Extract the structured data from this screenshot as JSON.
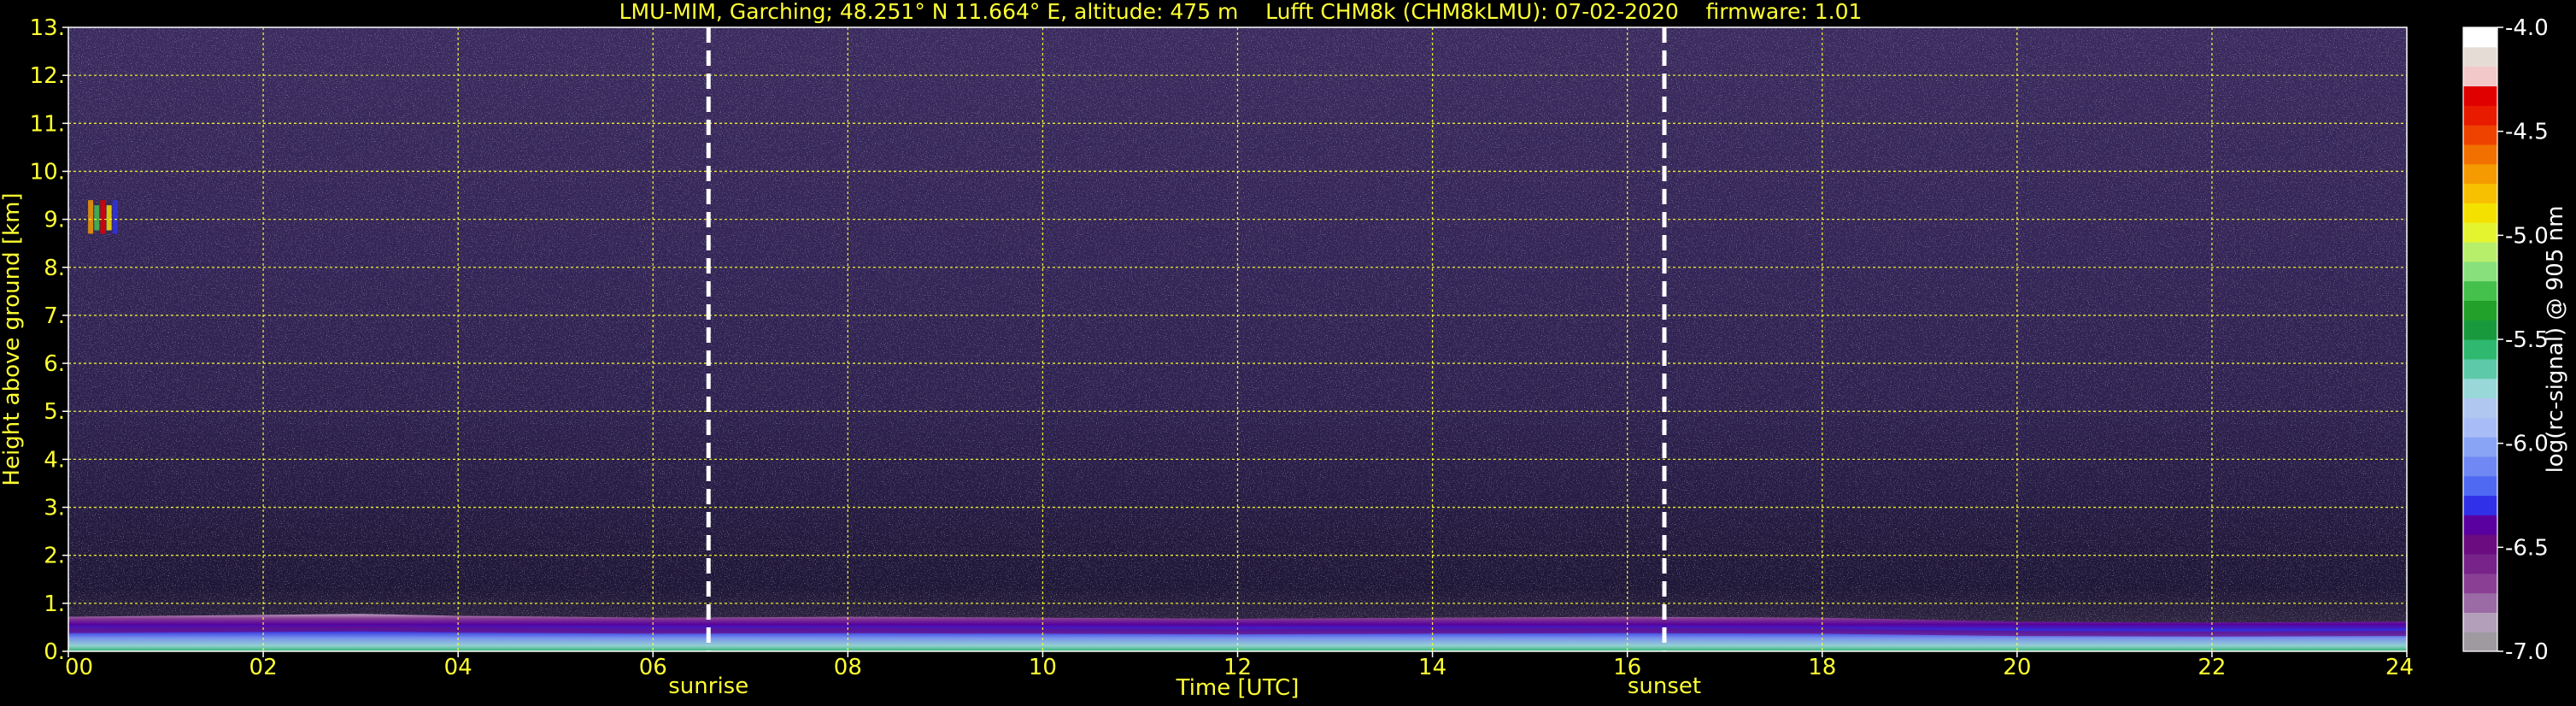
{
  "chart_data": {
    "type": "heatmap",
    "title": "LMU-MIM, Garching; 48.251° N 11.664° E, altitude: 475 m    Lufft CHM8k (CHM8kLMU): 07-02-2020    firmware: 1.01",
    "xlabel": "Time [UTC]",
    "ylabel": "Height above ground [km]",
    "xlim": [
      0,
      24
    ],
    "ylim": [
      0,
      13
    ],
    "x_ticks": [
      0,
      2,
      4,
      6,
      8,
      10,
      12,
      14,
      16,
      18,
      20,
      22,
      24
    ],
    "x_tick_labels": [
      "00",
      "02",
      "04",
      "06",
      "08",
      "10",
      "12",
      "14",
      "16",
      "18",
      "20",
      "22",
      "24"
    ],
    "y_ticks": [
      0,
      1,
      2,
      3,
      4,
      5,
      6,
      7,
      8,
      9,
      10,
      11,
      12,
      13
    ],
    "y_tick_labels": [
      "0.",
      "1.",
      "2.",
      "3.",
      "4.",
      "5.",
      "6.",
      "7.",
      "8.",
      "9.",
      "10.",
      "11.",
      "12.",
      "13."
    ],
    "grid": true,
    "markers": [
      {
        "time": 6.57,
        "label": "sunrise"
      },
      {
        "time": 16.38,
        "label": "sunset"
      }
    ],
    "boundary_layer_top_km": [
      [
        0,
        0.72
      ],
      [
        2,
        0.76
      ],
      [
        3,
        0.78
      ],
      [
        4,
        0.74
      ],
      [
        6,
        0.7
      ],
      [
        8,
        0.72
      ],
      [
        10,
        0.7
      ],
      [
        12,
        0.68
      ],
      [
        14,
        0.7
      ],
      [
        16,
        0.72
      ],
      [
        18,
        0.7
      ],
      [
        20,
        0.62
      ],
      [
        22,
        0.6
      ],
      [
        24,
        0.62
      ]
    ],
    "cloud_feature": {
      "time_start": 0.15,
      "time_end": 0.5,
      "height_km": [
        8.7,
        9.4
      ]
    },
    "colorbar": {
      "label": "log(rc-signal) @ 905 nm",
      "range": [
        -7.0,
        -4.0
      ],
      "ticks": [
        -7.0,
        -6.5,
        -6.0,
        -5.5,
        -5.0,
        -4.5,
        -4.0
      ],
      "tick_labels": [
        "-7.0",
        "-6.5",
        "-6.0",
        "-5.5",
        "-5.0",
        "-4.5",
        "-4.0"
      ],
      "colors": [
        "#9e9aa0",
        "#b39fb9",
        "#9a6ba4",
        "#8a3f95",
        "#77238a",
        "#6b0c80",
        "#5a00a0",
        "#3030e8",
        "#4f69f2",
        "#6f88f4",
        "#8aa4f5",
        "#a8bdf8",
        "#b0c8f0",
        "#98d8d8",
        "#5ec9a8",
        "#2fb870",
        "#189a3c",
        "#21a02a",
        "#44c04c",
        "#88e07c",
        "#b8ef6a",
        "#e4f530",
        "#f5e100",
        "#f7c000",
        "#f59a00",
        "#f27000",
        "#ee4200",
        "#e81a00",
        "#e00000",
        "#f2c8c8",
        "#e6dcd6",
        "#ffffff"
      ]
    }
  }
}
